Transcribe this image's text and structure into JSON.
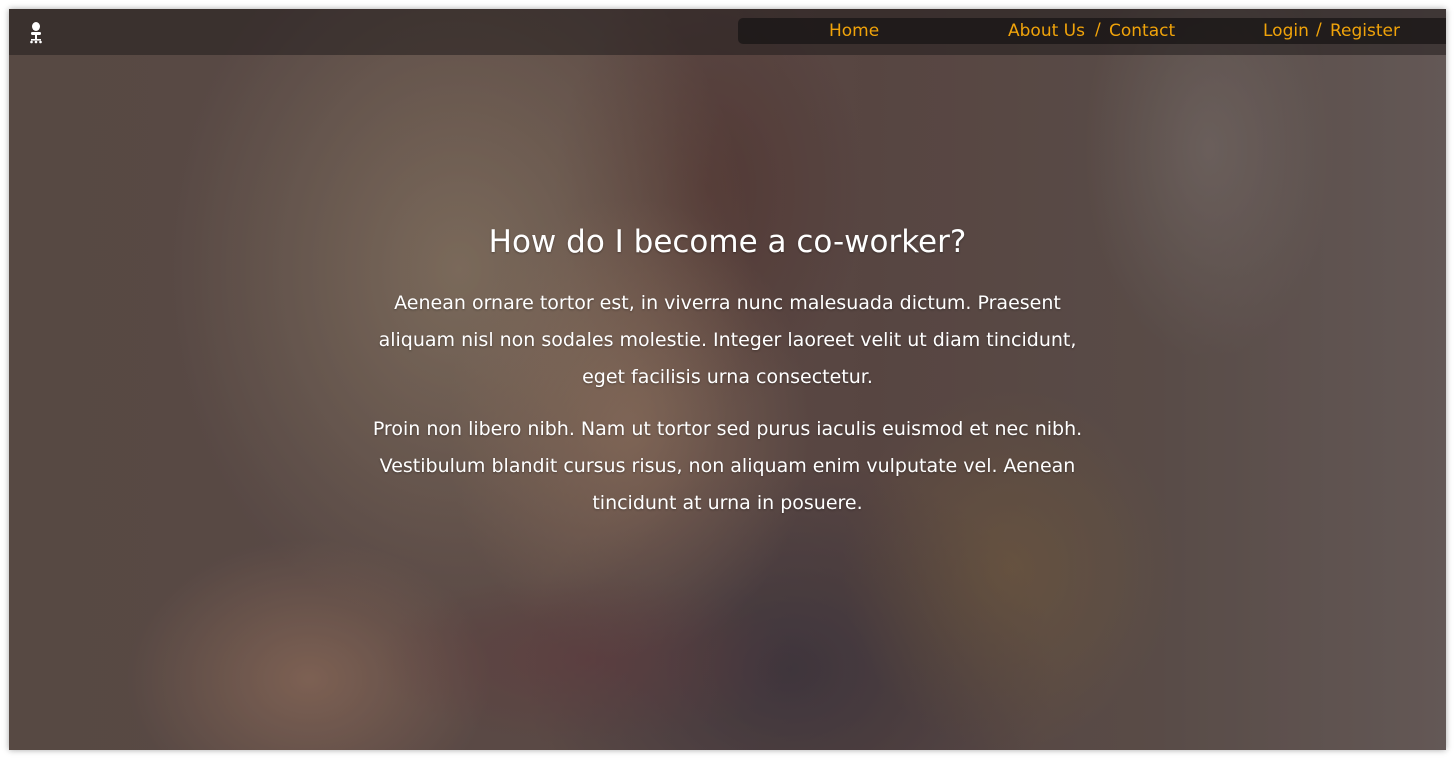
{
  "nav": {
    "home": "Home",
    "about": "About Us",
    "contact": "Contact",
    "login": "Login",
    "register": "Register",
    "separator": "/"
  },
  "hero": {
    "title": "How do I become a co-worker?",
    "paragraph1": "Aenean ornare tortor est, in viverra nunc malesuada dictum. Praesent aliquam nisl non sodales molestie. Integer laoreet velit ut diam tincidunt, eget facilisis urna consectetur.",
    "paragraph2": "Proin non libero nibh. Nam ut tortor sed purus iaculis euismod et nec nibh. Vestibulum blandit cursus risus, non aliquam enim vulputate vel. Aenean tincidunt at urna in posuere."
  },
  "icons": {
    "logo": "office-chair-icon"
  },
  "colors": {
    "nav_link": "#f0a30a",
    "text": "#ffffff"
  }
}
